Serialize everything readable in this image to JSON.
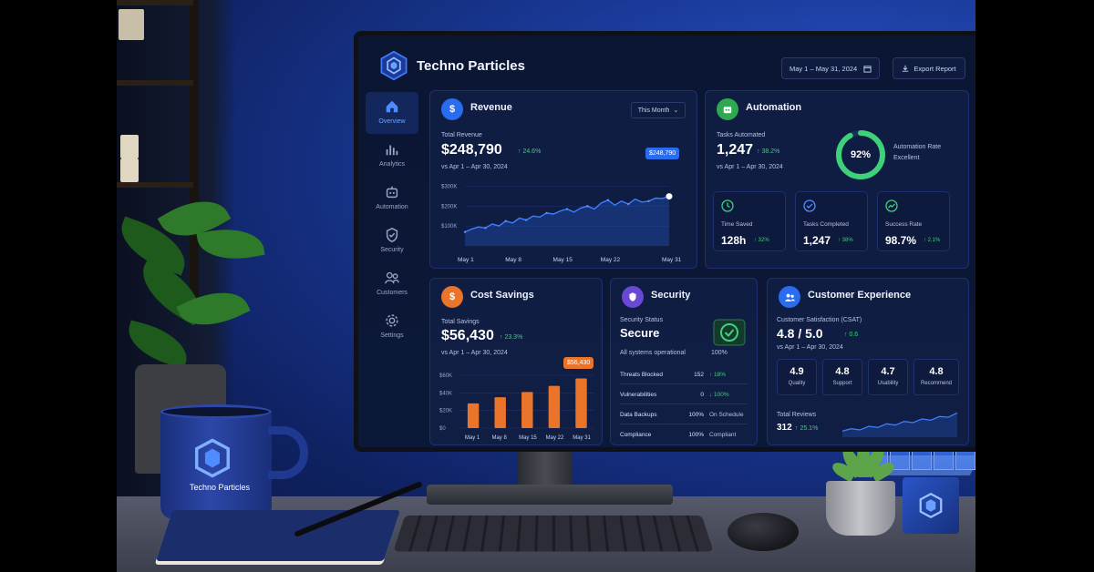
{
  "brand": {
    "name": "Techno Particles"
  },
  "header": {
    "date_range": "May 1 – May 31, 2024",
    "export_label": "Export Report"
  },
  "sidebar": {
    "items": [
      {
        "label": "Overview",
        "icon": "home-icon",
        "active": true
      },
      {
        "label": "Analytics",
        "icon": "bar-chart-icon",
        "active": false
      },
      {
        "label": "Automation",
        "icon": "robot-icon",
        "active": false
      },
      {
        "label": "Security",
        "icon": "shield-icon",
        "active": false
      },
      {
        "label": "Customers",
        "icon": "users-icon",
        "active": false
      },
      {
        "label": "Settings",
        "icon": "gear-icon",
        "active": false
      }
    ]
  },
  "revenue": {
    "title": "Revenue",
    "period_select": "This Month",
    "total_label": "Total Revenue",
    "total_value": "$248,790",
    "delta": "↑ 24.6%",
    "compare": "vs Apr 1 – Apr 30, 2024",
    "tooltip": "$248,790"
  },
  "automation": {
    "title": "Automation",
    "tasks_label": "Tasks Automated",
    "tasks_value": "1,247",
    "delta": "↑ 38.2%",
    "compare": "vs Apr 1 – Apr 30, 2024",
    "rate_value": "92%",
    "rate_fraction": 0.92,
    "rate_label": "Automation Rate",
    "rate_status": "Excellent",
    "minis": [
      {
        "label": "Time Saved",
        "value": "128h",
        "delta": "↑ 32%"
      },
      {
        "label": "Tasks Completed",
        "value": "1,247",
        "delta": "↑ 38%"
      },
      {
        "label": "Success Rate",
        "value": "98.7%",
        "delta": "↑ 2.1%"
      }
    ]
  },
  "cost_savings": {
    "title": "Cost Savings",
    "total_label": "Total Savings",
    "total_value": "$56,430",
    "delta": "↑ 23.3%",
    "compare": "vs Apr 1 – Apr 30, 2024",
    "tooltip": "$56,430"
  },
  "security": {
    "title": "Security",
    "status_label": "Security Status",
    "status_value": "Secure",
    "status_note": "All systems operational",
    "status_pct": "100%",
    "rows": [
      {
        "key": "Threats Blocked",
        "value": "152",
        "status": "↑ 18%"
      },
      {
        "key": "Vulnerabilities",
        "value": "0",
        "status": "↓ 100%"
      },
      {
        "key": "Data Backups",
        "value": "100%",
        "status": "On Schedule"
      },
      {
        "key": "Compliance",
        "value": "100%",
        "status": "Compliant"
      }
    ]
  },
  "customer_experience": {
    "title": "Customer Experience",
    "csat_label": "Customer Satisfaction (CSAT)",
    "csat_value": "4.8 / 5.0",
    "csat_delta": "↑ 0.6",
    "compare": "vs Apr 1 – Apr 30, 2024",
    "scores": [
      {
        "value": "4.9",
        "label": "Quality"
      },
      {
        "value": "4.8",
        "label": "Support"
      },
      {
        "value": "4.7",
        "label": "Usability"
      },
      {
        "value": "4.8",
        "label": "Recommend"
      }
    ],
    "reviews_label": "Total Reviews",
    "reviews_value": "312",
    "reviews_delta": "↑ 25.1%"
  },
  "mug": {
    "label": "Techno Particles"
  },
  "colors": {
    "accent_blue": "#2a6cf0",
    "accent_green": "#3fd07a",
    "accent_orange": "#e9742a",
    "accent_purple": "#6b47d6"
  },
  "chart_data": [
    {
      "type": "area",
      "title": "Revenue",
      "x_ticks": [
        "May 1",
        "May 8",
        "May 15",
        "May 22",
        "May 31"
      ],
      "y_ticks": [
        "$100K",
        "$200K",
        "$300K"
      ],
      "x": [
        1,
        2,
        3,
        4,
        5,
        6,
        7,
        8,
        9,
        10,
        11,
        12,
        13,
        14,
        15,
        16,
        17,
        18,
        19,
        20,
        21,
        22,
        23,
        24,
        25,
        26,
        27,
        28,
        29,
        30,
        31
      ],
      "values": [
        70,
        85,
        95,
        90,
        110,
        100,
        125,
        115,
        140,
        130,
        150,
        145,
        165,
        160,
        175,
        185,
        170,
        190,
        200,
        185,
        215,
        230,
        205,
        225,
        210,
        235,
        220,
        225,
        240,
        238,
        248.79
      ],
      "ylim": [
        0,
        320
      ]
    },
    {
      "type": "bar",
      "title": "Cost Savings",
      "categories": [
        "May 1",
        "May 8",
        "May 15",
        "May 22",
        "May 31"
      ],
      "values": [
        28,
        35,
        41,
        48,
        56.43
      ],
      "y_ticks": [
        "$0",
        "$20K",
        "$40K",
        "$60K"
      ],
      "ylim": [
        0,
        60
      ]
    },
    {
      "type": "line",
      "title": "Total Reviews",
      "values": [
        10,
        14,
        12,
        18,
        16,
        22,
        20,
        26,
        24,
        30,
        28,
        34,
        33,
        40
      ],
      "ylim": [
        0,
        45
      ]
    }
  ]
}
